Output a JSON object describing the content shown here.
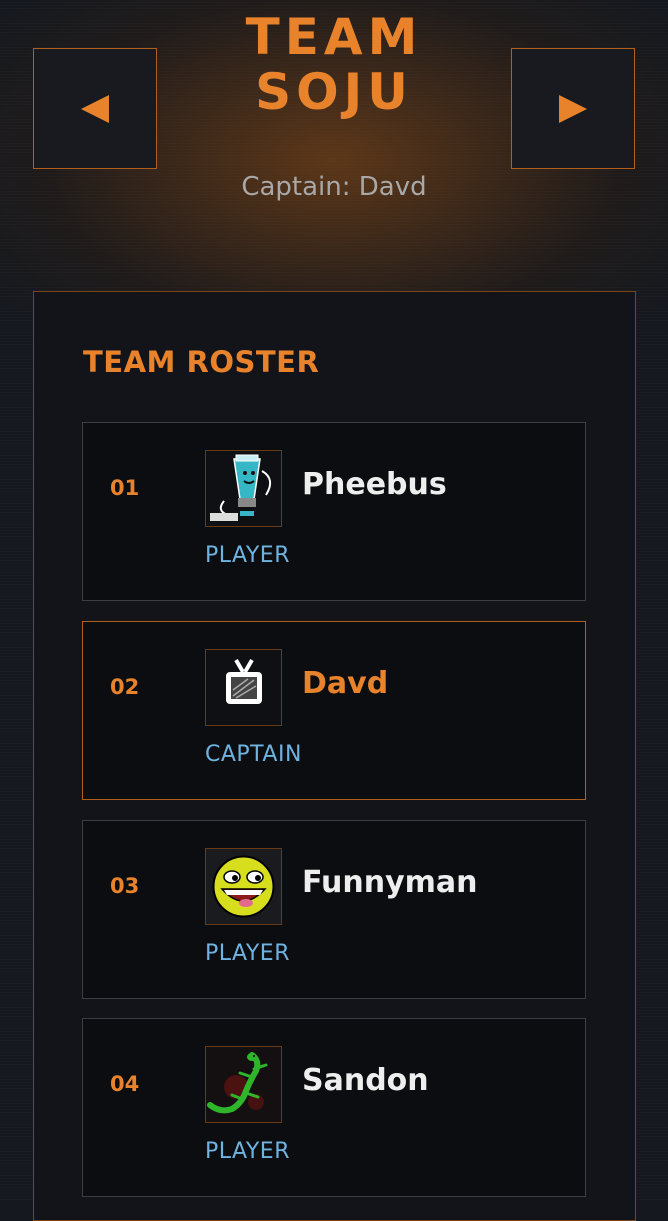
{
  "header": {
    "team_name": "TEAM SOJU",
    "captain_line": "Captain: Davd",
    "prev_icon": "triangle-left-icon",
    "next_icon": "triangle-right-icon"
  },
  "colors": {
    "accent": "#e8832c",
    "role": "#6fb3e0",
    "name": "#eeeeee",
    "card_bg": "#0c0d10"
  },
  "roster": {
    "title": "TEAM ROSTER",
    "members": [
      {
        "number": "01",
        "name": "Pheebus",
        "role": "PLAYER",
        "avatar": "paint-tube-avatar"
      },
      {
        "number": "02",
        "name": "Davd",
        "role": "CAPTAIN",
        "avatar": "tv-avatar"
      },
      {
        "number": "03",
        "name": "Funnyman",
        "role": "PLAYER",
        "avatar": "smiley-avatar"
      },
      {
        "number": "04",
        "name": "Sandon",
        "role": "PLAYER",
        "avatar": "lizard-avatar"
      }
    ]
  }
}
